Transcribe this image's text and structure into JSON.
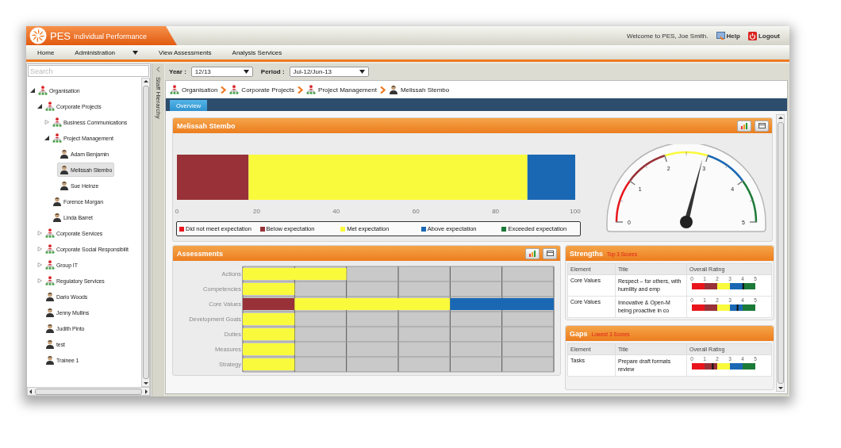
{
  "header": {
    "app_name": "PES",
    "app_subtitle": "Individual Performance",
    "welcome": "Welcome to PES, Joe Smith.",
    "links": [
      {
        "label": "Help",
        "kind": "help"
      },
      {
        "label": "Logout",
        "kind": "logout"
      }
    ]
  },
  "menu": [
    {
      "label": "Home",
      "has_dropdown": false
    },
    {
      "label": "Administration",
      "has_dropdown": true
    },
    {
      "label": "View Assessments",
      "has_dropdown": false
    },
    {
      "label": "Analysis Services",
      "has_dropdown": false
    }
  ],
  "sidebar": {
    "search": {
      "placeholder": "Search"
    },
    "collapse_label": "Staff Hierarchy",
    "tree": [
      {
        "label": "Organisation",
        "kind": "org",
        "expanded": true,
        "selected": false,
        "children": [
          {
            "label": "Corporate Projects",
            "kind": "org",
            "expanded": true,
            "selected": false,
            "children": [
              {
                "label": "Business Communications",
                "kind": "org",
                "expanded": false,
                "selected": false
              },
              {
                "label": "Project Management",
                "kind": "org",
                "expanded": true,
                "selected": false,
                "children": [
                  {
                    "label": "Adam Benjamin",
                    "kind": "person",
                    "selected": false
                  },
                  {
                    "label": "Melissah Stembo",
                    "kind": "person",
                    "selected": true
                  },
                  {
                    "label": "Sue Heinze",
                    "kind": "person",
                    "selected": false
                  }
                ]
              },
              {
                "label": "Forence Morgan",
                "kind": "person",
                "selected": false
              },
              {
                "label": "Linda Barret",
                "kind": "person",
                "selected": false
              }
            ]
          },
          {
            "label": "Corporate Services",
            "kind": "org",
            "expanded": false,
            "selected": false
          },
          {
            "label": "Corporate Social Responsibilit",
            "kind": "org",
            "expanded": false,
            "selected": false
          },
          {
            "label": "Group IT",
            "kind": "org",
            "expanded": false,
            "selected": false
          },
          {
            "label": "Regulatory Services",
            "kind": "org",
            "expanded": false,
            "selected": false
          },
          {
            "label": "Dario Woods",
            "kind": "person",
            "selected": false
          },
          {
            "label": "Jenny Mullins",
            "kind": "person",
            "selected": false
          },
          {
            "label": "Judith Pinto",
            "kind": "person",
            "selected": false
          },
          {
            "label": "test",
            "kind": "person",
            "selected": false
          },
          {
            "label": "Trainee 1",
            "kind": "person",
            "selected": false
          }
        ]
      }
    ]
  },
  "toolbar": {
    "year": {
      "label": "Year :",
      "value": "12/13"
    },
    "period": {
      "label": "Period :",
      "value": "Jul-12/Jun-13"
    }
  },
  "breadcrumb": [
    {
      "label": "Organisation",
      "kind": "org"
    },
    {
      "label": "Corporate Projects",
      "kind": "org"
    },
    {
      "label": "Project Management",
      "kind": "org"
    },
    {
      "label": "Melissah Stembo",
      "kind": "person"
    }
  ],
  "tabs": [
    {
      "label": "Overview",
      "selected": true
    }
  ],
  "overview": {
    "title": "Melissah Stembo",
    "chart_data": {
      "type": "bar",
      "orientation": "horizontal",
      "stacked": true,
      "categories": [
        null
      ],
      "xlim": [
        0,
        100
      ],
      "xticks": [
        0,
        20,
        40,
        60,
        80,
        100
      ],
      "series": [
        {
          "color": "#983238",
          "values": [
            18
          ]
        },
        {
          "color": "#fafa3c",
          "values": [
            70
          ]
        },
        {
          "color": "#1a68b4",
          "values": [
            12
          ]
        }
      ]
    },
    "legend": [
      {
        "name": "Did not meet expectation",
        "color": "#e8161c"
      },
      {
        "name": "Below expectation",
        "color": "#983238"
      },
      {
        "name": "Met expectation",
        "color": "#fafa3c"
      },
      {
        "name": "Above expectation",
        "color": "#1a68b4"
      },
      {
        "name": "Exceeded expectation",
        "color": "#1c7a38"
      }
    ],
    "gauge": {
      "ticks": [
        "0",
        "1",
        "2",
        "3",
        "4",
        "5"
      ]
    }
  },
  "assessments": {
    "title": "Assessments",
    "categories": [
      "Actions",
      "Competencies",
      "Core Values",
      "Development Goals",
      "Duties",
      "Measures",
      "Strategy"
    ]
  },
  "strengths": {
    "title": "Strengths",
    "subtitle": "Top 3 Scores",
    "columns": [
      "Element",
      "Title",
      "Overall Rating"
    ],
    "rows": [
      {
        "element": "Core Values",
        "title": "Respect – for others, with humility and emp",
        "rating": {
          "ticks": [
            "0",
            "1",
            "2",
            "3",
            "4",
            "5"
          ],
          "level": 0.81
        }
      },
      {
        "element": "Core Values",
        "title": "Innovative & Open-M being proactive in co",
        "rating": {
          "ticks": [
            "0",
            "1",
            "2",
            "3",
            "4",
            "5"
          ],
          "level": 0.72
        }
      }
    ]
  },
  "gaps": {
    "title": "Gaps",
    "subtitle": "Lowest 3 Scores",
    "columns": [
      "Element",
      "Title",
      "Overall Rating"
    ],
    "rows": [
      {
        "element": "Tasks",
        "title": "Prepare draft formats review",
        "rating": {
          "ticks": [
            "0",
            "1",
            "2",
            "3",
            "4",
            "5"
          ],
          "level": 0.33
        }
      }
    ]
  }
}
